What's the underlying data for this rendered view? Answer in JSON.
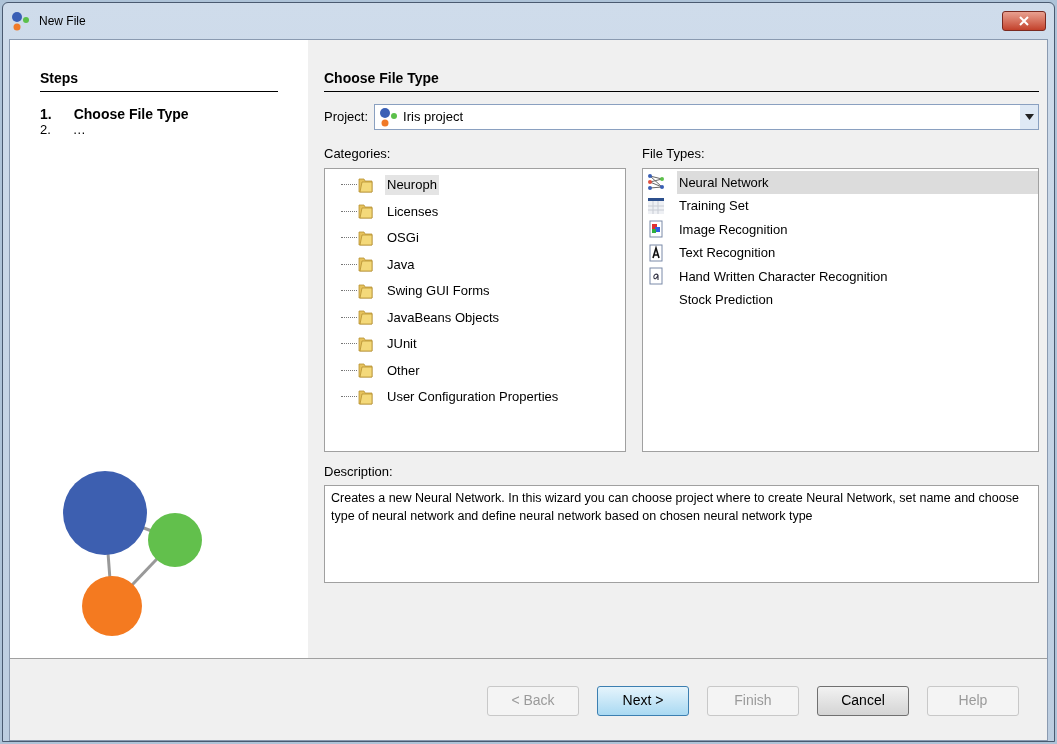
{
  "window": {
    "title": "New File"
  },
  "steps": {
    "title": "Steps",
    "items": [
      {
        "number": "1.",
        "label": "Choose File Type",
        "selected": true
      },
      {
        "number": "2.",
        "label": "…",
        "selected": false
      }
    ]
  },
  "panel": {
    "title": "Choose File Type"
  },
  "project": {
    "label": "Project:",
    "value": "Iris project"
  },
  "categories": {
    "label": "Categories:",
    "items": [
      {
        "label": "Neuroph",
        "selected": true
      },
      {
        "label": "Licenses",
        "selected": false
      },
      {
        "label": "OSGi",
        "selected": false
      },
      {
        "label": "Java",
        "selected": false
      },
      {
        "label": "Swing GUI Forms",
        "selected": false
      },
      {
        "label": "JavaBeans Objects",
        "selected": false
      },
      {
        "label": "JUnit",
        "selected": false
      },
      {
        "label": "Other",
        "selected": false
      },
      {
        "label": "User Configuration Properties",
        "selected": false
      }
    ]
  },
  "file_types": {
    "label": "File Types:",
    "items": [
      {
        "label": "Neural Network",
        "kind": "network",
        "selected": true
      },
      {
        "label": "Training Set",
        "kind": "table",
        "selected": false
      },
      {
        "label": "Image Recognition",
        "kind": "image",
        "selected": false
      },
      {
        "label": "Text Recognition",
        "kind": "text",
        "selected": false
      },
      {
        "label": "Hand Written Character Recognition",
        "kind": "handwriting",
        "selected": false
      },
      {
        "label": "Stock Prediction",
        "kind": "none",
        "selected": false
      }
    ]
  },
  "description": {
    "label": "Description:",
    "text": "Creates a new Neural Network. In this wizard you can choose project where to create Neural Network, set name and choose type of neural network and define neural network based on chosen neural network type"
  },
  "buttons": [
    {
      "label": "< Back",
      "disabled": true,
      "default": false
    },
    {
      "label": "Next >",
      "disabled": false,
      "default": true
    },
    {
      "label": "Finish",
      "disabled": true,
      "default": false
    },
    {
      "label": "Cancel",
      "disabled": false,
      "default": false
    },
    {
      "label": "Help",
      "disabled": true,
      "default": false
    }
  ]
}
